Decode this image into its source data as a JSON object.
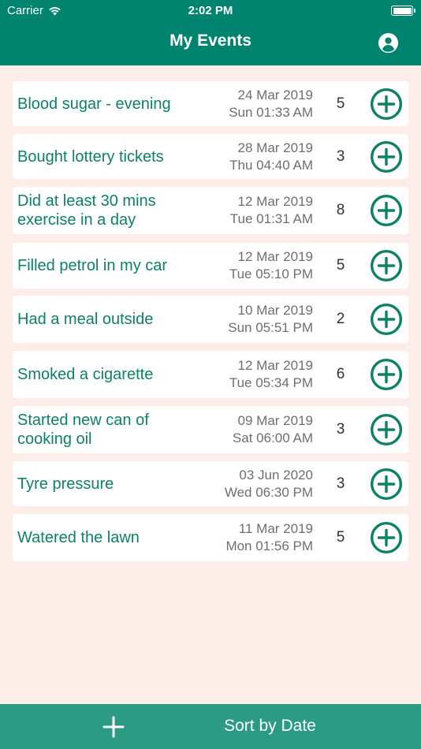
{
  "status_bar": {
    "carrier": "Carrier",
    "time": "2:02 PM"
  },
  "header": {
    "title": "My Events",
    "profile_icon": "person-circle-icon"
  },
  "colors": {
    "header_bg": "#00846f",
    "accent": "#0e8068",
    "page_bg": "#fcede8",
    "bottom_bar_bg": "#2b9b84"
  },
  "events": [
    {
      "name": "Blood sugar - evening",
      "date": "24 Mar 2019",
      "time": "Sun 01:33 AM",
      "count": "5"
    },
    {
      "name": "Bought lottery tickets",
      "date": "28 Mar 2019",
      "time": "Thu 04:40 AM",
      "count": "3"
    },
    {
      "name": "Did at least 30 mins exercise in a day",
      "date": "12 Mar 2019",
      "time": "Tue 01:31 AM",
      "count": "8"
    },
    {
      "name": "Filled petrol in my car",
      "date": "12 Mar 2019",
      "time": "Tue 05:10 PM",
      "count": "5"
    },
    {
      "name": "Had a meal outside",
      "date": "10 Mar 2019",
      "time": "Sun 05:51 PM",
      "count": "2"
    },
    {
      "name": "Smoked a cigarette",
      "date": "12 Mar 2019",
      "time": "Tue 05:34 PM",
      "count": "6"
    },
    {
      "name": "Started new can of cooking oil",
      "date": "09 Mar 2019",
      "time": "Sat 06:00 AM",
      "count": "3"
    },
    {
      "name": "Tyre pressure",
      "date": "03 Jun 2020",
      "time": "Wed 06:30 PM",
      "count": "3"
    },
    {
      "name": "Watered the lawn",
      "date": "11 Mar 2019",
      "time": "Mon 01:56 PM",
      "count": "5"
    }
  ],
  "bottom_bar": {
    "add_icon": "plus-icon",
    "sort_label": "Sort by Date"
  }
}
